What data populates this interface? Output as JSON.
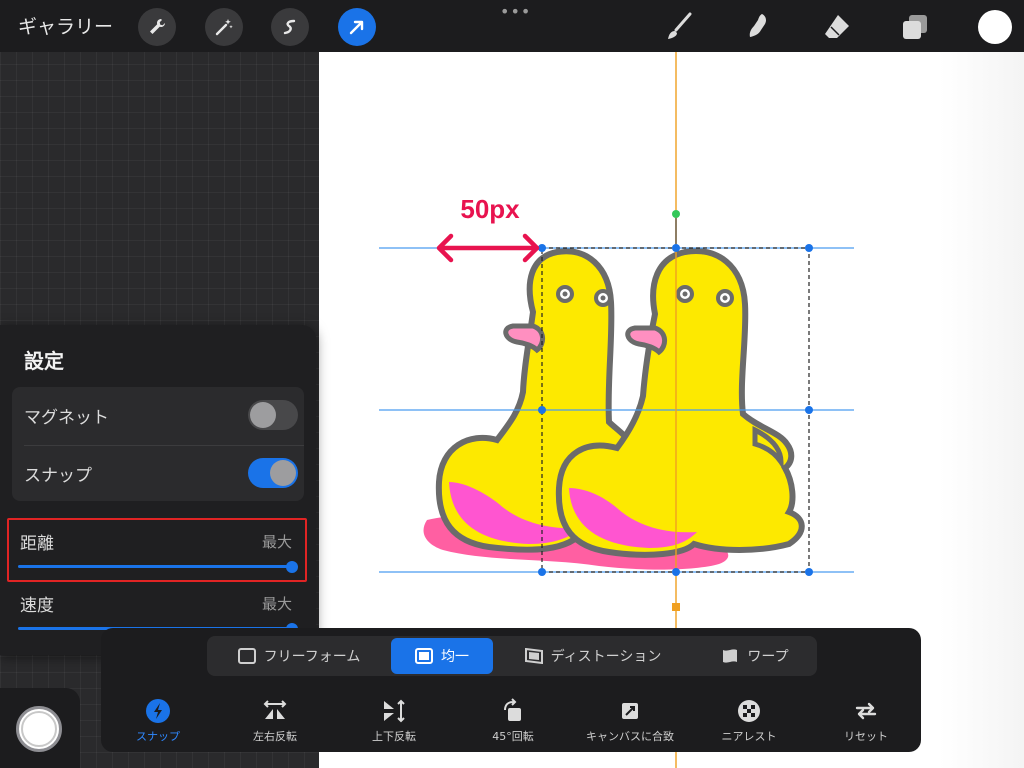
{
  "topbar": {
    "gallery_label": "ギャラリー",
    "more": "•••",
    "icons": [
      "wrench-icon",
      "magic-wand-icon",
      "selection-icon",
      "transform-arrow-icon",
      "brush-icon",
      "smudge-icon",
      "eraser-icon",
      "layers-icon",
      "color-icon"
    ],
    "accent": "#1a73e8"
  },
  "annotation": {
    "distance_label": "50px",
    "color": "#e8134f"
  },
  "settings": {
    "title": "設定",
    "magnet_label": "マグネット",
    "magnet_on": false,
    "snap_label": "スナップ",
    "snap_on": true,
    "distance_label": "距離",
    "distance_value": "最大",
    "distance_level": 1.0,
    "speed_label": "速度",
    "speed_value": "最大",
    "speed_level": 1.0
  },
  "modes": {
    "freeform": "フリーフォーム",
    "uniform": "均一",
    "distort": "ディストーション",
    "warp": "ワープ"
  },
  "tools": {
    "snap": "スナップ",
    "flip_h": "左右反転",
    "flip_v": "上下反転",
    "rotate45": "45°回転",
    "fit_canvas": "キャンバスに合致",
    "nearest": "ニアレスト",
    "reset": "リセット"
  }
}
